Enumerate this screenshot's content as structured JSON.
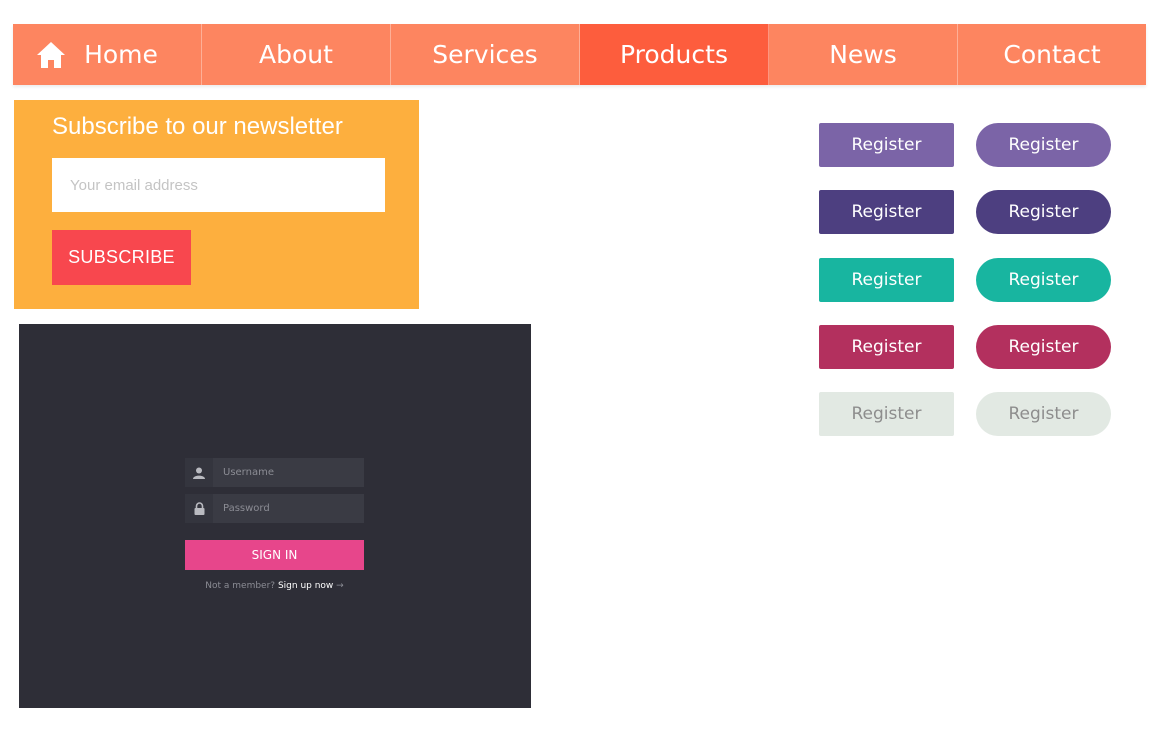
{
  "nav": {
    "items": [
      {
        "label": "Home",
        "icon": "home-icon"
      },
      {
        "label": "About"
      },
      {
        "label": "Services"
      },
      {
        "label": "Products",
        "active": true
      },
      {
        "label": "News"
      },
      {
        "label": "Contact"
      }
    ],
    "bg_color": "#fd8560",
    "active_color": "#fd5d3d"
  },
  "newsletter": {
    "title": "Subscribe to our newsletter",
    "email_placeholder": "Your email address",
    "subscribe_label": "SUBSCRIBE",
    "bg_color": "#fdaf3e",
    "button_color": "#f8474e"
  },
  "login": {
    "username_placeholder": "Username",
    "password_placeholder": "Password",
    "signin_label": "SIGN IN",
    "not_member_text": "Not a member?",
    "signup_link": "Sign up now",
    "signup_arrow": "→",
    "panel_color": "#2e2e37",
    "button_color": "#e7468b"
  },
  "register_buttons": {
    "label": "Register",
    "rows": [
      {
        "color": "#7b64a7",
        "text_color": "#ffffff"
      },
      {
        "color": "#4d3f80",
        "text_color": "#ffffff"
      },
      {
        "color": "#18b5a0",
        "text_color": "#ffffff"
      },
      {
        "color": "#b3305e",
        "text_color": "#ffffff"
      },
      {
        "color": "#e2e9e3",
        "text_color": "#8d8d8d"
      }
    ]
  }
}
